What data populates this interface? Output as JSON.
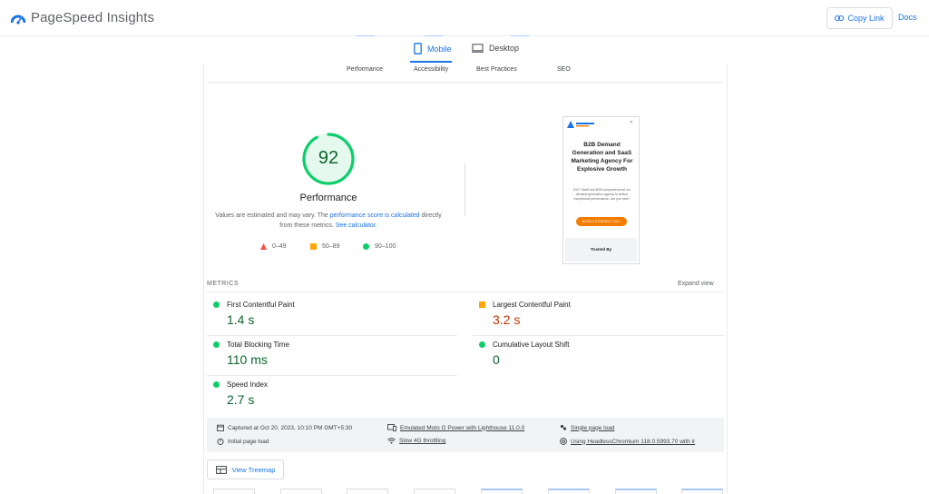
{
  "header": {
    "brand": "PageSpeed Insights",
    "copy_link": "Copy Link",
    "docs": "Docs"
  },
  "device_tabs": [
    {
      "label": "Mobile",
      "active": true
    },
    {
      "label": "Desktop",
      "active": false
    }
  ],
  "category_tabs": [
    "Performance",
    "Accessibility",
    "Best Practices",
    "SEO"
  ],
  "score": {
    "value": "92",
    "fraction": 0.92,
    "color": "#0cce6b",
    "label": "Performance",
    "note_pre": "Values are estimated and may vary. The ",
    "note_link1": "performance score is calculated",
    "note_mid": " directly from these metrics. ",
    "note_link2": "See calculator."
  },
  "legend": [
    {
      "range": "0–49",
      "color": "#ff4e42",
      "shape": "triangle"
    },
    {
      "range": "50–89",
      "color": "#ffa400",
      "shape": "square"
    },
    {
      "range": "90–100",
      "color": "#0cce6b",
      "shape": "circle"
    }
  ],
  "screenshot": {
    "title": "B2B Demand Generation and SaaS Marketing Agency For Explosive Growth",
    "subtitle": "100+ SaaS and B2B companies trust our demand generation agency to deliver exceptional performance. Are you next?",
    "cta": "BOOK A STRATEGY CALL",
    "footer": "Trusted By"
  },
  "metrics": {
    "heading": "METRICS",
    "expand": "Expand view",
    "items": [
      {
        "name": "First Contentful Paint",
        "value": "1.4 s",
        "status": "good"
      },
      {
        "name": "Largest Contentful Paint",
        "value": "3.2 s",
        "status": "average"
      },
      {
        "name": "Total Blocking Time",
        "value": "110 ms",
        "status": "good"
      },
      {
        "name": "Cumulative Layout Shift",
        "value": "0",
        "status": "good"
      },
      {
        "name": "Speed Index",
        "value": "2.7 s",
        "status": "good"
      }
    ]
  },
  "environment": [
    {
      "text": "Captured at Oct 20, 2023, 10:10 PM GMT+5:30",
      "icon": "calendar-icon",
      "link": false
    },
    {
      "text": "Emulated Moto G Power with Lighthouse 11.0.0",
      "icon": "device-icon",
      "link": true
    },
    {
      "text": "Single page load",
      "icon": "people-icon",
      "link": true
    },
    {
      "text": "Initial page load",
      "icon": "timer-icon",
      "link": false
    },
    {
      "text": "Slow 4G throttling",
      "icon": "wifi-icon",
      "link": true
    },
    {
      "text": "Using HeadlessChromium 118.0.5993.70 with lr",
      "icon": "chrome-icon",
      "link": true
    }
  ],
  "treemap": {
    "label": "View Treemap"
  },
  "colors": {
    "accent": "#1a73e8",
    "good": "#0cce6b",
    "good_text": "#0d652d",
    "average": "#ffa400",
    "average_text": "#c33300",
    "poor": "#ff4e42"
  }
}
